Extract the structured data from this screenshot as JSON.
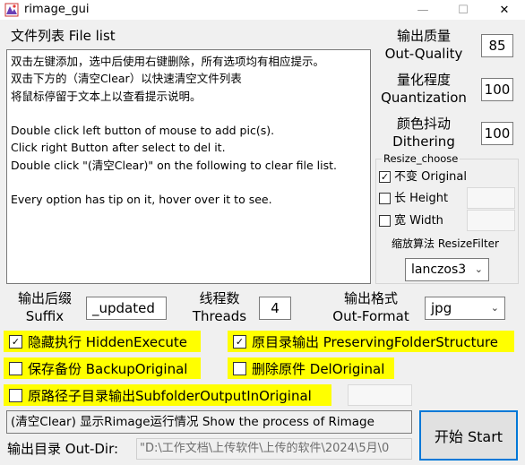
{
  "window": {
    "title": "rimage_gui",
    "min": "—",
    "max": "☐",
    "close": "✕"
  },
  "file_list": {
    "title": "文件列表 File list",
    "lines": [
      "双击左键添加，选中后使用右键删除，所有选项均有相应提示。",
      "双击下方的（清空Clear）以快速清空文件列表",
      "将鼠标停留于文本上以查看提示说明。",
      "",
      "Double click left button of mouse to add pic(s).",
      "Click right Button after select to del it.",
      "Double click \"(清空Clear)\" on the following to clear file list.",
      "",
      "Every option has tip on it, hover over it to see."
    ]
  },
  "quality": {
    "label_cn": "输出质量",
    "label_en": "Out-Quality",
    "value": "85"
  },
  "quantization": {
    "label_cn": "量化程度",
    "label_en": "Quantization",
    "value": "100"
  },
  "dithering": {
    "label_cn": "颜色抖动",
    "label_en": "Dithering",
    "value": "100"
  },
  "resize": {
    "title": "Resize_choose",
    "options": [
      {
        "label": "不变 Original",
        "checked": true
      },
      {
        "label": "长 Height",
        "checked": false
      },
      {
        "label": "宽 Width",
        "checked": false
      }
    ],
    "filter_label": "缩放算法 ResizeFilter",
    "filter_value": "lanczos3"
  },
  "suffix": {
    "label_cn": "输出后缀",
    "label_en": "Suffix",
    "value": "_updated"
  },
  "threads": {
    "label_cn": "线程数",
    "label_en": "Threads",
    "value": "4"
  },
  "format": {
    "label_cn": "输出格式",
    "label_en": "Out-Format",
    "value": "jpg"
  },
  "options": {
    "hidden_execute": {
      "label": "隐藏执行 HiddenExecute",
      "checked": true
    },
    "preserving_structure": {
      "label": "原目录输出 PreservingFolderStructure",
      "checked": true
    },
    "backup_original": {
      "label": "保存备份 BackupOriginal",
      "checked": false
    },
    "del_original": {
      "label": "删除原件 DelOriginal",
      "checked": false
    },
    "subfolder_output": {
      "label": "原路径子目录输出SubfolderOutputInOriginal",
      "checked": false
    }
  },
  "status": "(清空Clear) 显示Rimage运行情况 Show the process of Rimage",
  "start_label": "开始 Start",
  "outdir": {
    "label": "输出目录 Out-Dir:",
    "value": "\"D:\\工作文档\\上传软件\\上传的软件\\2024\\5月\\0"
  },
  "colors": {
    "highlight": "#ffff00",
    "focus_border": "#0078d7"
  }
}
